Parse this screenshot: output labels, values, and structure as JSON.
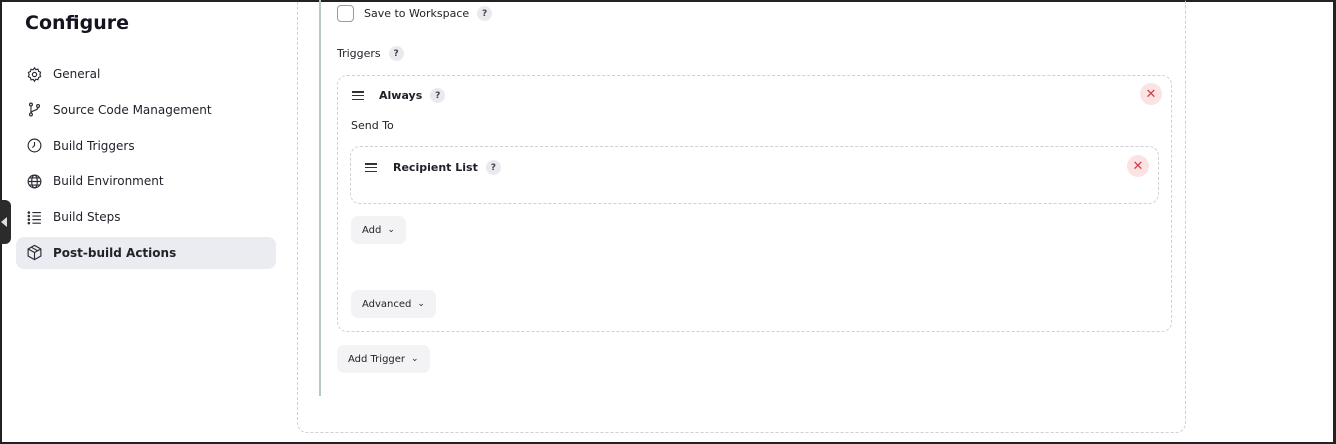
{
  "title": "Configure",
  "nav": {
    "items": [
      {
        "label": "General",
        "icon": "gear-icon"
      },
      {
        "label": "Source Code Management",
        "icon": "branch-icon"
      },
      {
        "label": "Build Triggers",
        "icon": "clock-icon"
      },
      {
        "label": "Build Environment",
        "icon": "globe-icon"
      },
      {
        "label": "Build Steps",
        "icon": "list-icon"
      },
      {
        "label": "Post-build Actions",
        "icon": "package-icon",
        "active": true
      }
    ]
  },
  "main": {
    "save_workspace_label": "Save to Workspace",
    "triggers_label": "Triggers",
    "trigger": {
      "name": "Always",
      "send_to_label": "Send To",
      "recipient": {
        "name": "Recipient List"
      },
      "add_label": "Add",
      "advanced_label": "Advanced"
    },
    "add_trigger_label": "Add Trigger",
    "help_glyph": "?",
    "close_glyph": "✕",
    "chevron_glyph": "⌄"
  },
  "colors": {
    "active_nav_bg": "#ebebf2",
    "delete_bg": "#fbe3e4",
    "delete_fg": "#d23c44"
  }
}
